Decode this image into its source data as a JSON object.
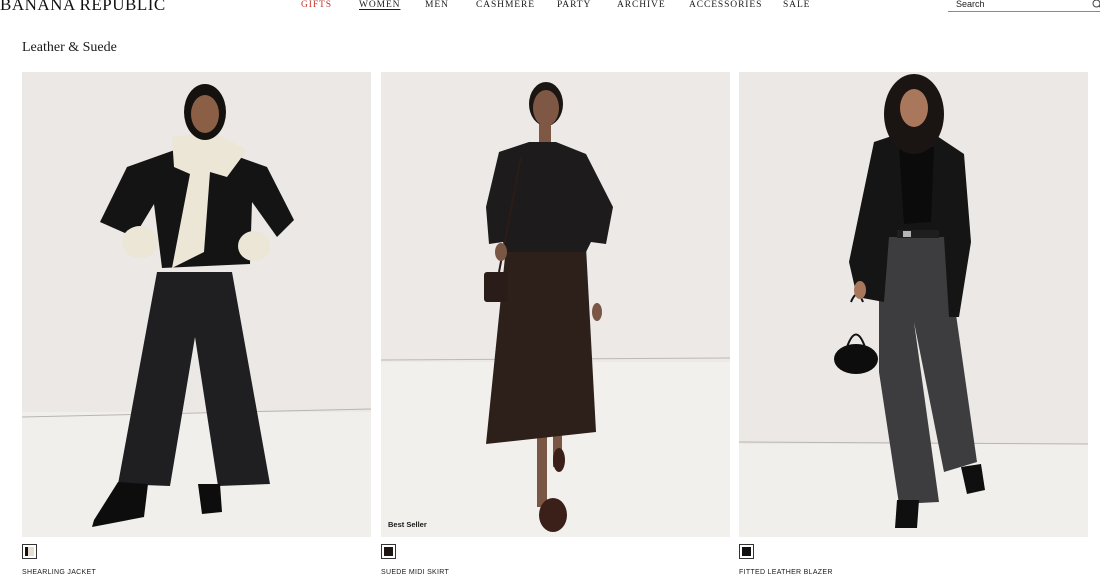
{
  "header": {
    "logo": "BANANA REPUBLIC",
    "nav": [
      {
        "label": "GIFTS"
      },
      {
        "label": "WOMEN"
      },
      {
        "label": "MEN"
      },
      {
        "label": "CASHMERE"
      },
      {
        "label": "PARTY"
      },
      {
        "label": "ARCHIVE"
      },
      {
        "label": "ACCESSORIES"
      },
      {
        "label": "SALE"
      }
    ],
    "search": {
      "placeholder": "Search",
      "icon": "search-icon"
    },
    "colors": {
      "gifts": "#c8322c",
      "text": "#1a1a1a"
    }
  },
  "page": {
    "title": "Leather & Suede"
  },
  "products": [
    {
      "name": "SHEARLING JACKET",
      "badge": "",
      "swatch_color": "#e6dfcf",
      "swatch_accent": "#111111"
    },
    {
      "name": "SUEDE MIDI SKIRT",
      "badge": "Best Seller",
      "swatch_color": "#1c1614"
    },
    {
      "name": "FITTED LEATHER BLAZER",
      "badge": "",
      "swatch_color": "#111111"
    }
  ]
}
